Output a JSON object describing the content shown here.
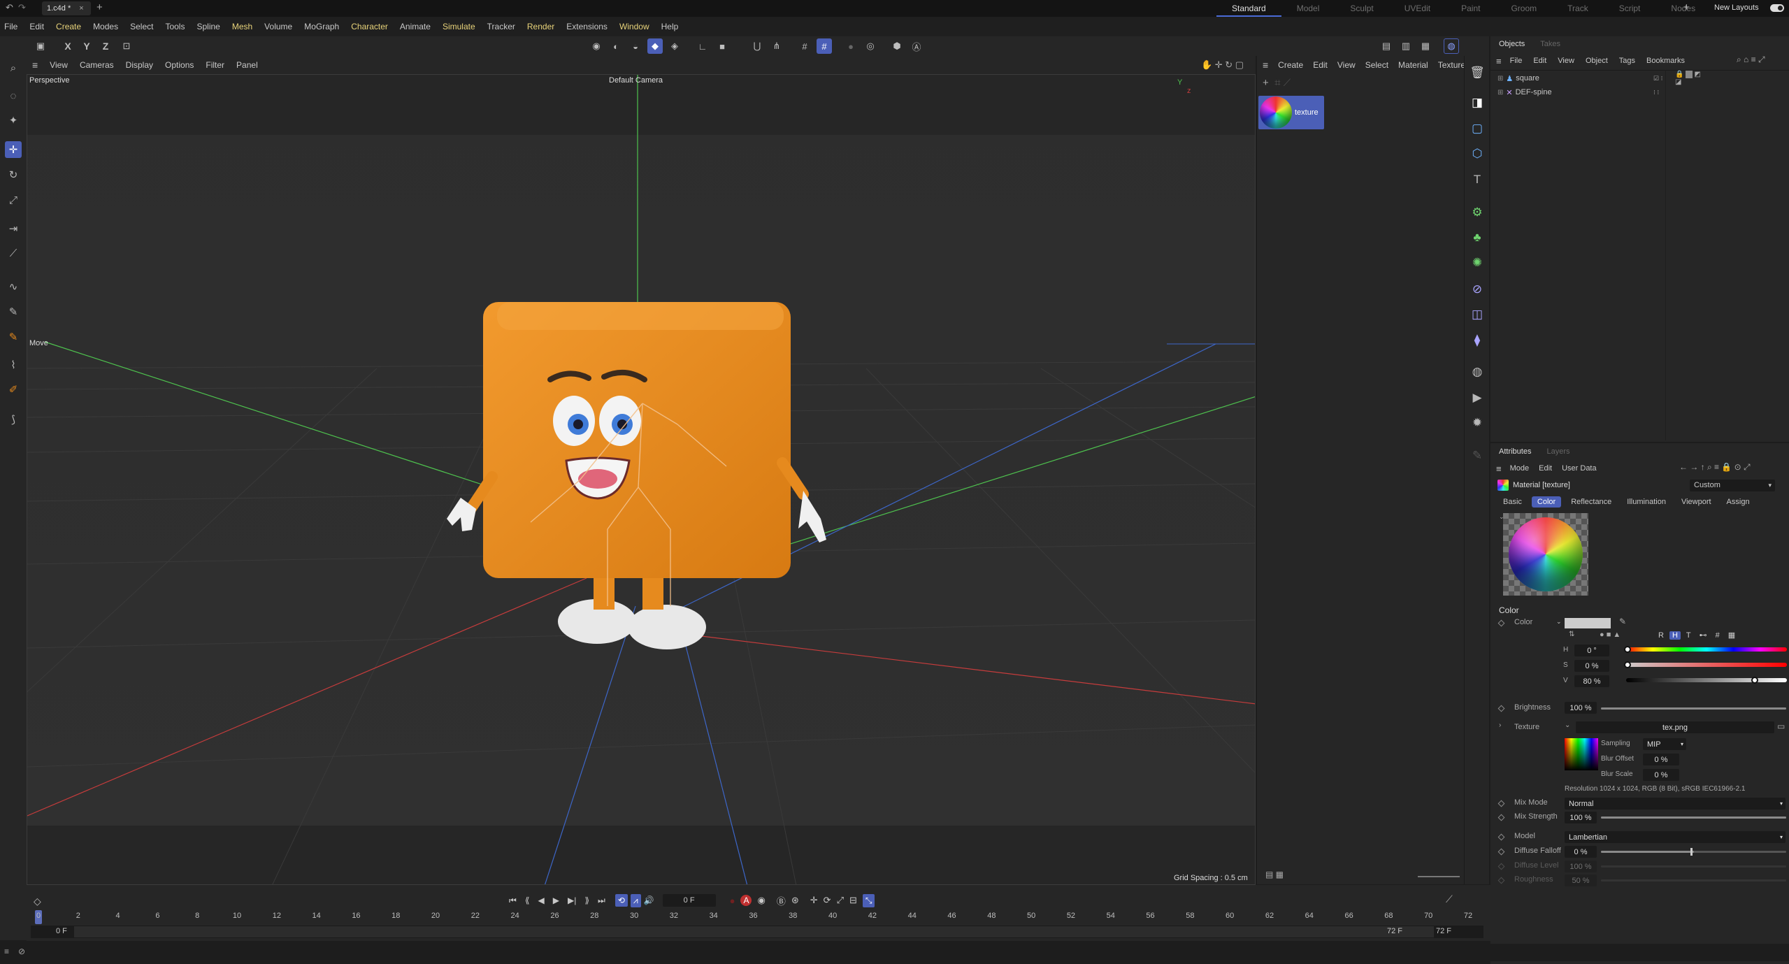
{
  "titlebar": {
    "file_tab": "1.c4d *",
    "layouts": [
      "Standard",
      "Model",
      "Sculpt",
      "UVEdit",
      "Paint",
      "Groom",
      "Track",
      "Script",
      "Nodes"
    ],
    "new_layouts": "New Layouts"
  },
  "menu": [
    "File",
    "Edit",
    "Create",
    "Modes",
    "Select",
    "Tools",
    "Spline",
    "Mesh",
    "Volume",
    "MoGraph",
    "Character",
    "Animate",
    "Simulate",
    "Tracker",
    "Render",
    "Extensions",
    "Window",
    "Help"
  ],
  "axis_toggles": [
    "X",
    "Y",
    "Z"
  ],
  "viewport": {
    "menu": [
      "View",
      "Cameras",
      "Display",
      "Options",
      "Filter",
      "Panel"
    ],
    "view_name": "Perspective",
    "camera": "Default Camera",
    "tool_label": "Move",
    "grid_spacing": "Grid Spacing : 0.5 cm"
  },
  "material_manager": {
    "menu": [
      "Create",
      "Edit",
      "View",
      "Select",
      "Material",
      "Texture"
    ],
    "material_name": "texture"
  },
  "objects": {
    "tabs": [
      "Objects",
      "Takes"
    ],
    "menu": [
      "File",
      "Edit",
      "View",
      "Object",
      "Tags",
      "Bookmarks"
    ],
    "items": [
      "square",
      "DEF-spine"
    ]
  },
  "attributes": {
    "tabs": [
      "Attributes",
      "Layers"
    ],
    "menu": [
      "Mode",
      "Edit",
      "User Data"
    ],
    "title": "Material [texture]",
    "preset": "Custom",
    "subtabs": [
      "Basic",
      "Color",
      "Reflectance",
      "Illumination",
      "Viewport",
      "Assign"
    ],
    "active_subtab": "Color",
    "section": "Color",
    "color_label": "Color",
    "channel_buttons": [
      "R",
      "H",
      "T",
      "#"
    ],
    "h_label": "H",
    "h_value": "0 °",
    "s_label": "S",
    "s_value": "0 %",
    "v_label": "V",
    "v_value": "80 %",
    "brightness_label": "Brightness",
    "brightness_value": "100 %",
    "texture_label": "Texture",
    "texture_file": "tex.png",
    "sampling_label": "Sampling",
    "sampling_value": "MIP",
    "blur_offset_label": "Blur Offset",
    "blur_offset_value": "0 %",
    "blur_scale_label": "Blur Scale",
    "blur_scale_value": "0 %",
    "resolution": "Resolution 1024 x 1024, RGB (8 Bit), sRGB IEC61966-2.1",
    "mix_mode_label": "Mix Mode",
    "mix_mode_value": "Normal",
    "mix_strength_label": "Mix Strength",
    "mix_strength_value": "100 %",
    "model_label": "Model",
    "model_value": "Lambertian",
    "diffuse_falloff_label": "Diffuse Falloff",
    "diffuse_falloff_value": "0 %",
    "diffuse_level_label": "Diffuse Level",
    "diffuse_level_value": "100 %",
    "roughness_label": "Roughness",
    "roughness_value": "50 %",
    "color_v": 0.8,
    "brightness": 1.0,
    "mix_strength": 1.0,
    "diffuse_falloff": 0.5
  },
  "timeline": {
    "frame_display": "0 F",
    "ticks": [
      "0",
      "2",
      "4",
      "6",
      "8",
      "10",
      "12",
      "14",
      "16",
      "18",
      "20",
      "22",
      "24",
      "26",
      "28",
      "30",
      "32",
      "34",
      "36",
      "38",
      "40",
      "42",
      "44",
      "46",
      "48",
      "50",
      "52",
      "54",
      "56",
      "58",
      "60",
      "62",
      "64",
      "66",
      "68",
      "70",
      "72"
    ],
    "start_a": "0 F",
    "start_b": "0 F",
    "end_a": "72 F",
    "end_b": "72 F"
  },
  "colors": {
    "accent": "#4b5fb7",
    "character_orange": "#e68a1e"
  }
}
